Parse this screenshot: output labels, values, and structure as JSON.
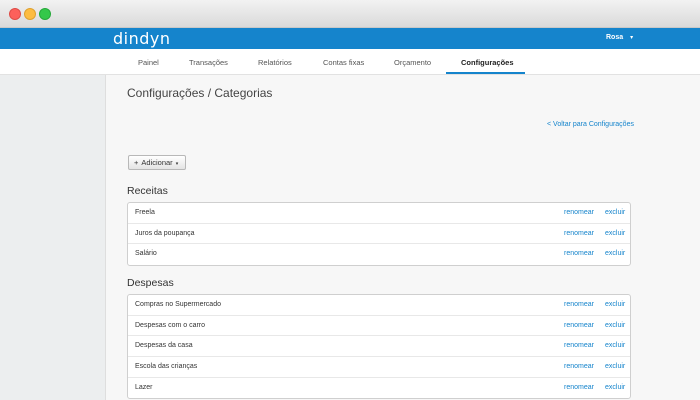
{
  "app": {
    "logo": "dindyn",
    "user": "Rosa",
    "user_caret": "▾"
  },
  "nav": [
    {
      "label": "Painel",
      "active": false
    },
    {
      "label": "Transações",
      "active": false
    },
    {
      "label": "Relatórios",
      "active": false
    },
    {
      "label": "Contas fixas",
      "active": false
    },
    {
      "label": "Orçamento",
      "active": false
    },
    {
      "label": "Configurações",
      "active": true
    }
  ],
  "page": {
    "title": "Configurações / Categorias",
    "back_link": "< Voltar para Configurações",
    "add_button": {
      "icon": "+",
      "label": "Adicionar",
      "caret": "▾"
    }
  },
  "actions": {
    "rename": "renomear",
    "delete": "excluir"
  },
  "sections": [
    {
      "title": "Receitas",
      "items": [
        "Freela",
        "Juros da poupança",
        "Salário"
      ]
    },
    {
      "title": "Despesas",
      "items": [
        "Compras no Supermercado",
        "Despesas com o carro",
        "Despesas da casa",
        "Escola das crianças",
        "Lazer"
      ]
    }
  ]
}
